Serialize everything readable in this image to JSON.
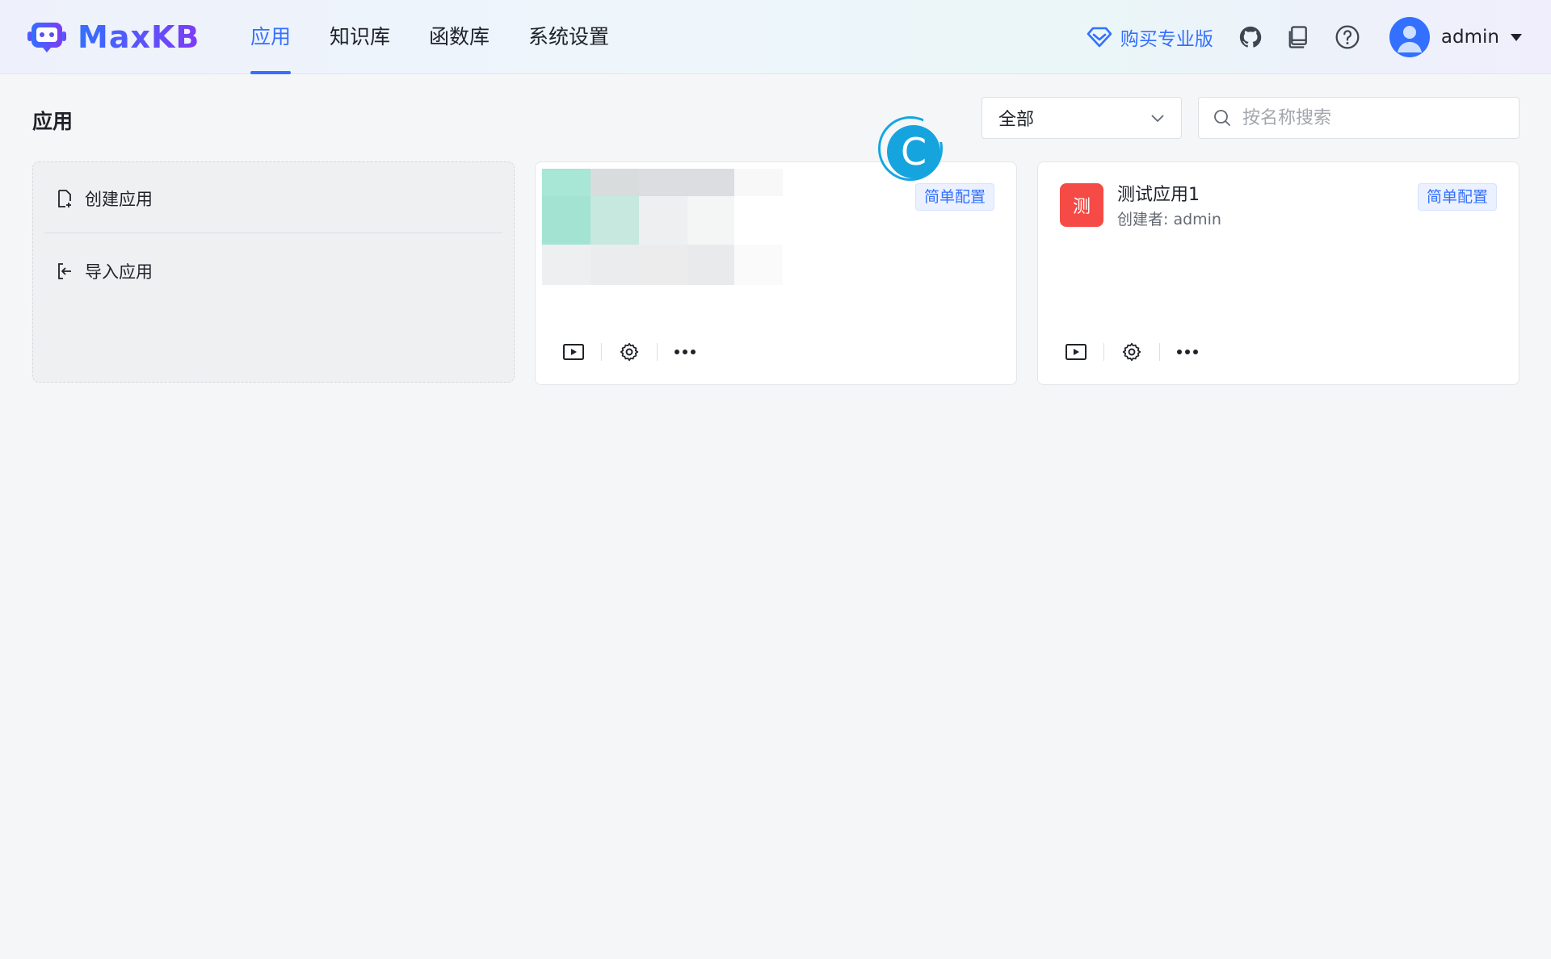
{
  "app": {
    "brand": "MaxKB"
  },
  "nav": {
    "items": [
      {
        "label": "应用",
        "active": true
      },
      {
        "label": "知识库",
        "active": false
      },
      {
        "label": "函数库",
        "active": false
      },
      {
        "label": "系统设置",
        "active": false
      }
    ]
  },
  "header": {
    "pro_label": "购买专业版",
    "icons": [
      "github-icon",
      "book-icon",
      "help-icon"
    ],
    "user_name": "admin"
  },
  "page": {
    "title": "应用",
    "filter_value": "全部",
    "search_placeholder": "按名称搜索"
  },
  "create_card": {
    "create_label": "创建应用",
    "import_label": "导入应用"
  },
  "apps": [
    {
      "name": "",
      "creator": "",
      "tag": "简单配置",
      "icon_char": "",
      "blurred": true
    },
    {
      "name": "测试应用1",
      "creator": "创建者: admin",
      "tag": "简单配置",
      "icon_char": "测",
      "icon_color": "#f54a45"
    }
  ],
  "overlay": {
    "badge_letter": "C"
  },
  "colors": {
    "primary": "#3370ff",
    "app_icon": "#f54a45",
    "badge": "#16a4de"
  }
}
